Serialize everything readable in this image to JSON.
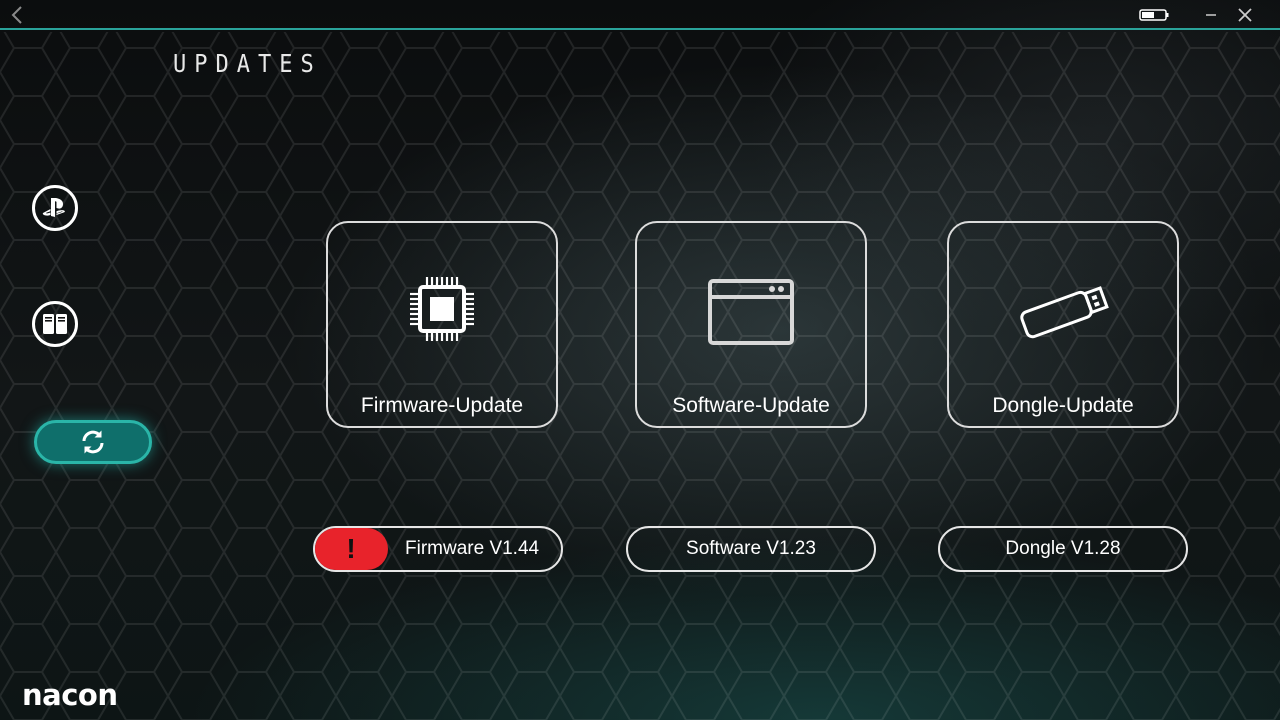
{
  "app": {
    "page_title": "UPDATES",
    "logo_text": "nacon",
    "accent_color": "#2aa39a",
    "alert_color": "#e8232b"
  },
  "titlebar": {
    "back_icon": "chevron-left-icon",
    "battery_icon": "battery-icon",
    "minimize_icon": "minimize-icon",
    "close_icon": "close-icon"
  },
  "sidebar": {
    "items": [
      {
        "icon": "playstation-icon",
        "active": false
      },
      {
        "icon": "pc-tower-icon",
        "active": false
      },
      {
        "icon": "refresh-icon",
        "active": true
      }
    ]
  },
  "cards": [
    {
      "label": "Firmware-Update",
      "icon": "chip-icon"
    },
    {
      "label": "Software-Update",
      "icon": "app-window-icon"
    },
    {
      "label": "Dongle-Update",
      "icon": "usb-dongle-icon"
    }
  ],
  "versions": [
    {
      "label": "Firmware V1.44",
      "alert": "!"
    },
    {
      "label": "Software V1.23"
    },
    {
      "label": "Dongle V1.28"
    }
  ]
}
